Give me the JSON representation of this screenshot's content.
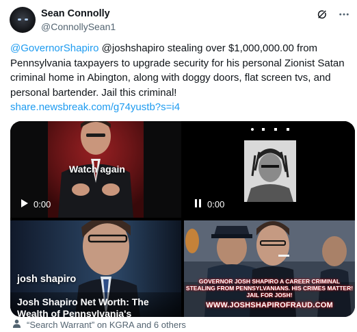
{
  "author": {
    "display_name": "Sean Connolly",
    "handle": "@ConnollySean1"
  },
  "tweet": {
    "mention": "@GovernorShapiro",
    "body": " @joshshapiro stealing over $1,000,000.00 from Pennsylvania taxpayers to upgrade security for his personal Zionist Satan criminal home in Abington, along with doggy doors, flat screen tvs, and personal bartender.  Jail this criminal!",
    "link": "share.newsbreak.com/g74yustb?s=i4"
  },
  "media": {
    "video1": {
      "overlay": "Watch again",
      "time": "0:00",
      "control_icon": "play-icon"
    },
    "video2": {
      "time": "0:00",
      "control_icon": "pause-icon"
    },
    "card": {
      "caption": "josh shapiro",
      "title": "Josh Shapiro Net Worth: The Wealth of Pennsylvania's Governor"
    },
    "banner": {
      "headline": "GOVERNOR JOSH SHAPIRO A CAREER CRIMINAL STEALING FROM PENNSYLVANIANS.   HIS CRIMES MATTER! JAIL FOR JOSH!",
      "url": "WWW.JOSHSHAPIROFRAUD.COM"
    }
  },
  "tagged": {
    "icon": "person-icon",
    "text": "“Search Warrant” on KGRA and 6 others"
  },
  "colors": {
    "accent": "#1d9bf0",
    "secondary_text": "#536471",
    "banner_glow": "#c0161c"
  }
}
